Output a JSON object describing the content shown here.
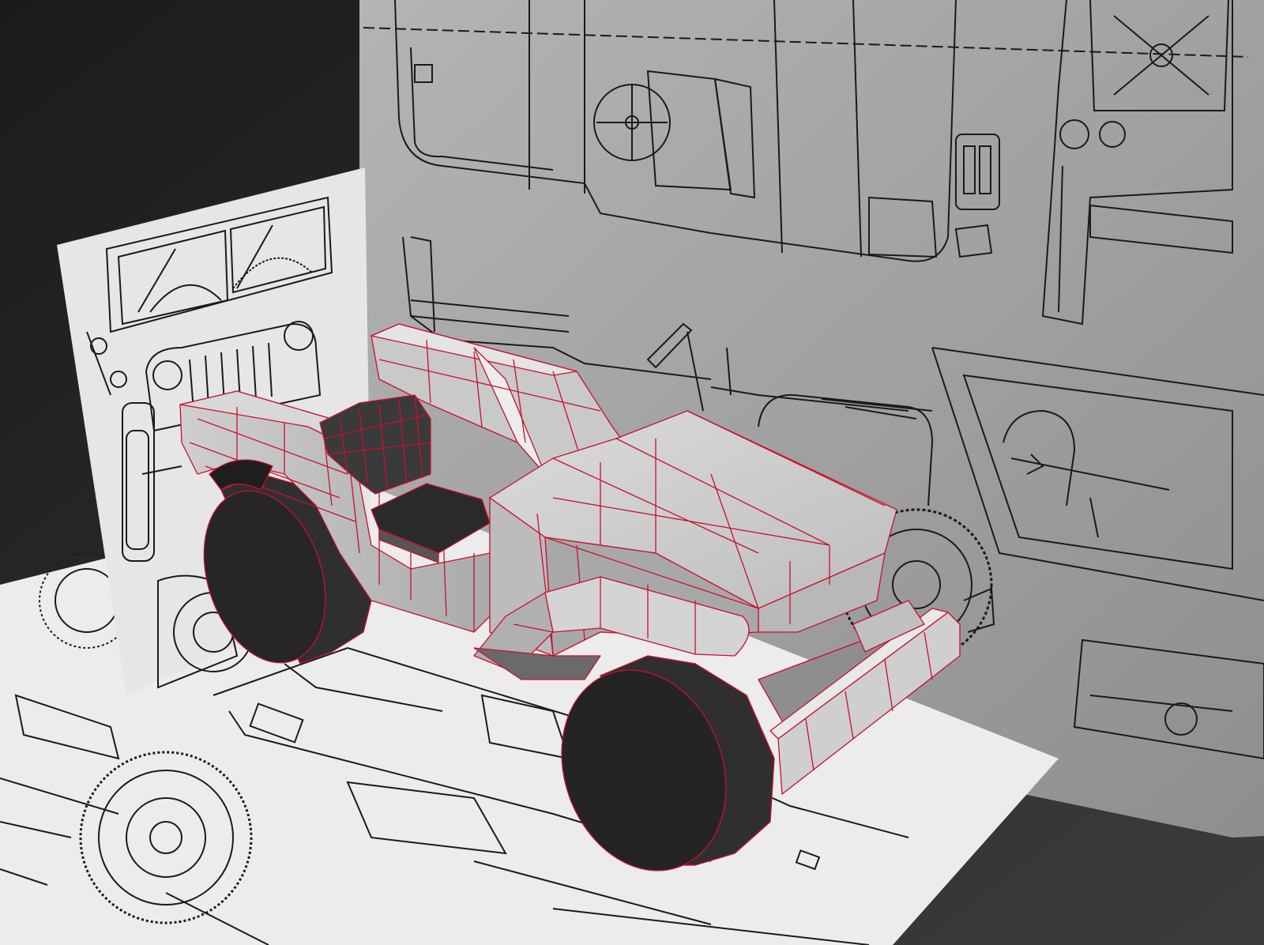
{
  "viewport": {
    "kind": "3d-modeling-perspective-view",
    "background_colors": [
      "#1b1b1b",
      "#3c3c3c"
    ],
    "wireframe_color": "#c8102e",
    "mesh_shade_light": "#cfcfcf",
    "mesh_shade_dark": "#2e2e2e",
    "blueprint_wall_color": "#9c9c9c",
    "blueprint_side_color": "#e6e6e6",
    "blueprint_floor_color": "#ececec",
    "line_color": "#1a1a1a"
  },
  "scene": {
    "planes": [
      {
        "name": "back-blueprint-plane",
        "view": "top-view-and-side-view-drawing"
      },
      {
        "name": "left-blueprint-plane",
        "view": "front-view-drawing"
      },
      {
        "name": "floor-blueprint-plane",
        "view": "side-view-drawing"
      }
    ],
    "model": {
      "name": "jeep-low-poly-model",
      "parts": [
        "hood",
        "body-tub",
        "windshield-frame",
        "seat-back",
        "seat-cushion",
        "front-fender",
        "rear-fender",
        "front-bumper",
        "front-wheel",
        "rear-wheel"
      ]
    }
  }
}
